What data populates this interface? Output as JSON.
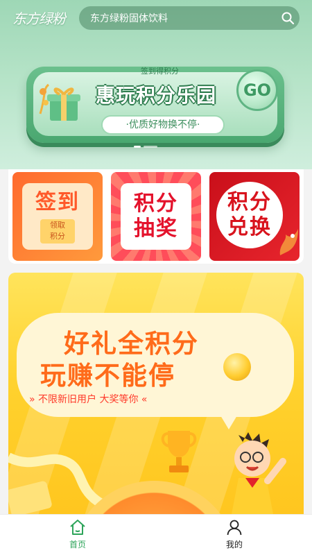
{
  "header": {
    "logo_text": "东方绿粉",
    "search": {
      "placeholder": "东方绿粉固体饮料"
    }
  },
  "hero_banner": {
    "kicker": "签到得积分",
    "title": "惠玩积分乐园",
    "go_label": "GO",
    "pill_text": "·优质好物换不停·",
    "carousel_count": 2,
    "carousel_active": 0
  },
  "tiles": [
    {
      "lines": [
        "签到"
      ],
      "badge": [
        "领取",
        "积分"
      ]
    },
    {
      "lines": [
        "积分",
        "抽奖"
      ]
    },
    {
      "lines": [
        "积分",
        "兑换"
      ]
    }
  ],
  "promo": {
    "headline_1": "好礼全积分",
    "headline_2": "玩赚不能停",
    "subline": "» 不限新旧用户 大奖等你 «"
  },
  "tabbar": {
    "items": [
      {
        "label": "首页",
        "icon": "home-icon",
        "active": true
      },
      {
        "label": "我的",
        "icon": "person-icon",
        "active": false
      }
    ],
    "active_color": "#2da45a"
  },
  "colors": {
    "brand_green": "#2da45a",
    "hero_green": "#4aa770",
    "promo_orange": "#ff6b1a"
  }
}
